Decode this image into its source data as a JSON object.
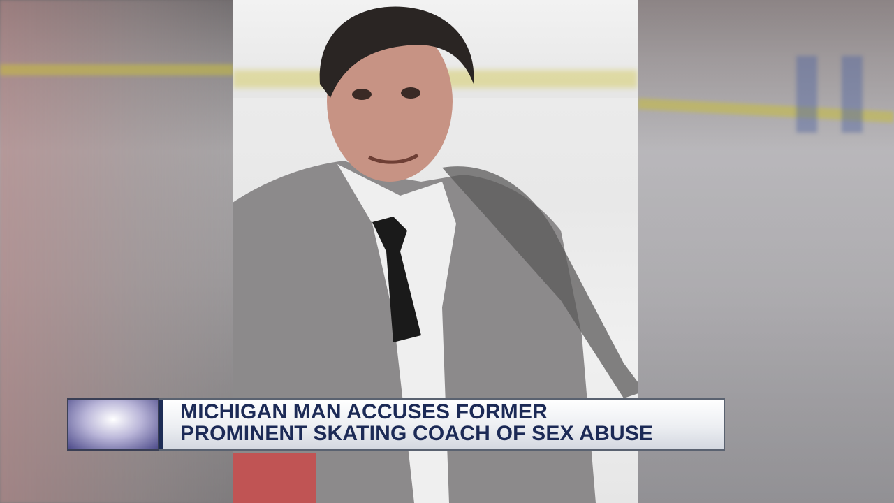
{
  "lower_third": {
    "headline_line1": "MICHIGAN MAN ACCUSES FORMER",
    "headline_line2": "PROMINENT SKATING COACH OF SEX ABUSE"
  },
  "colors": {
    "headline_text": "#1c2a56",
    "bar_accent": "#1d2c55"
  }
}
